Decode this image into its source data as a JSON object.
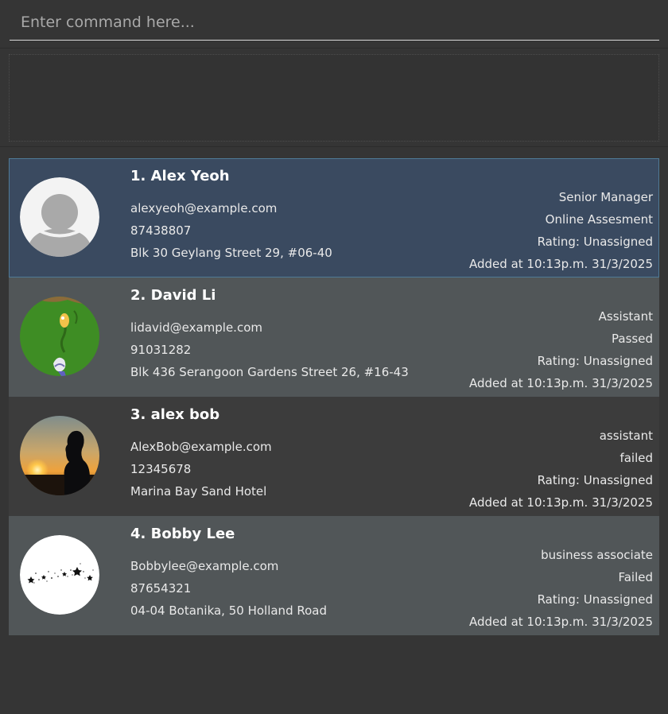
{
  "command_box": {
    "placeholder": "Enter command here...",
    "value": ""
  },
  "result_display": {
    "text": ""
  },
  "persons": [
    {
      "index_name": "1. Alex Yeoh",
      "email": "alexyeoh@example.com",
      "phone": "87438807",
      "address": "Blk 30 Geylang Street 29, #06-40",
      "role": "Senior Manager",
      "status": "Online Assesment",
      "rating": "Rating: Unassigned",
      "added": "Added at 10:13p.m. 31/3/2025",
      "avatar": "default-user-avatar",
      "selected": true
    },
    {
      "index_name": "2. David Li",
      "email": "lidavid@example.com",
      "phone": "91031282",
      "address": "Blk 436 Serangoon Gardens Street 26, #16-43",
      "role": "Assistant",
      "status": "Passed",
      "rating": "Rating: Unassigned",
      "added": "Added at 10:13p.m. 31/3/2025",
      "avatar": "cartoon-photo-avatar",
      "selected": false
    },
    {
      "index_name": "3. alex bob",
      "email": "AlexBob@example.com",
      "phone": "12345678",
      "address": "Marina Bay Sand Hotel",
      "role": "assistant",
      "status": "failed",
      "rating": "Rating: Unassigned",
      "added": "Added at 10:13p.m. 31/3/2025",
      "avatar": "sunset-silhouette-avatar",
      "selected": false
    },
    {
      "index_name": "4. Bobby Lee",
      "email": "Bobbylee@example.com",
      "phone": "87654321",
      "address": "04-04 Botanika, 50 Holland Road",
      "role": "business associate",
      "status": "Failed",
      "rating": "Rating: Unassigned",
      "added": "Added at 10:13p.m. 31/3/2025",
      "avatar": "stars-avatar",
      "selected": false
    }
  ],
  "colors": {
    "background": "#353535",
    "card_odd": "#515658",
    "card_even": "#3c3c3c",
    "card_selected": "#3a4a60",
    "text": "#e9e9e9"
  }
}
